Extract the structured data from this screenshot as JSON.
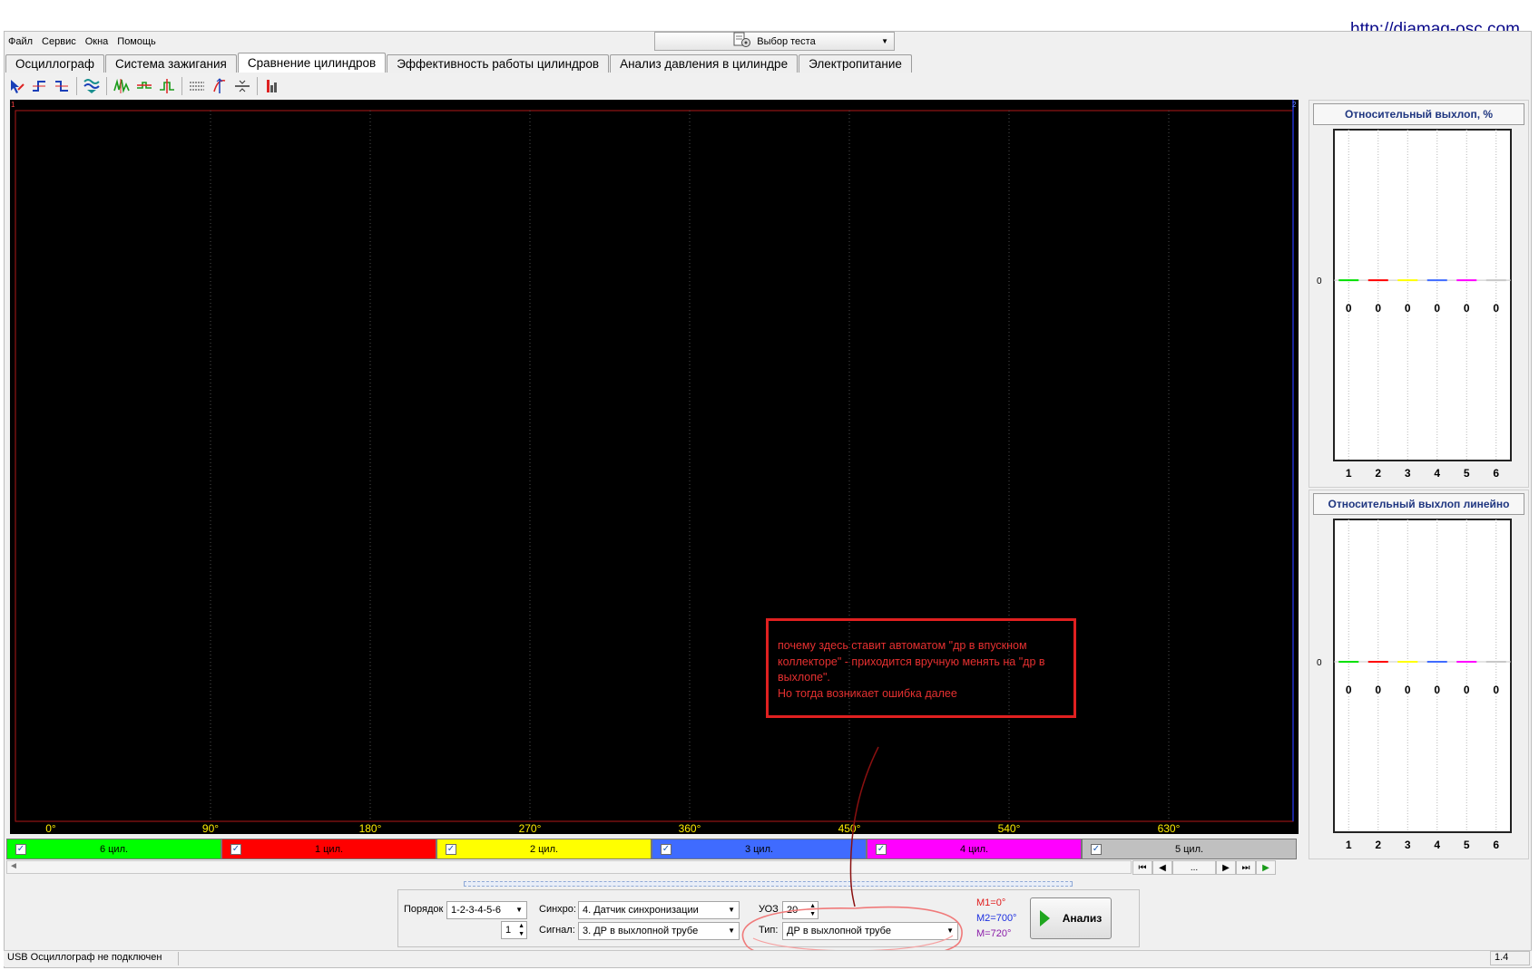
{
  "site_url": "http://diamag-osc.com",
  "menu": [
    "Файл",
    "Сервис",
    "Окна",
    "Помощь"
  ],
  "test_select": {
    "label": "Выбор теста"
  },
  "tabs": [
    {
      "label": "Осциллограф",
      "active": false
    },
    {
      "label": "Система зажигания",
      "active": false
    },
    {
      "label": "Сравнение цилиндров",
      "active": true
    },
    {
      "label": "Эффективность работы цилиндров",
      "active": false
    },
    {
      "label": "Анализ давления в цилиндре",
      "active": false
    },
    {
      "label": "Электропитание",
      "active": false
    }
  ],
  "scope": {
    "x_ticks": [
      "0°",
      "90°",
      "180°",
      "270°",
      "360°",
      "450°",
      "540°",
      "630°"
    ],
    "marker_1": "1",
    "marker_2": "2"
  },
  "channels": [
    {
      "label": "6 цил.",
      "color": "#00ff00",
      "checked": true
    },
    {
      "label": "1 цил.",
      "color": "#ff0000",
      "checked": true
    },
    {
      "label": "2 цил.",
      "color": "#ffff00",
      "checked": true
    },
    {
      "label": "3 цил.",
      "color": "#3f6bff",
      "checked": true
    },
    {
      "label": "4 цил.",
      "color": "#ff00ff",
      "checked": true
    },
    {
      "label": "5 цил.",
      "color": "#c0c0c0",
      "checked": true
    }
  ],
  "nav": {
    "ellipsis": "..."
  },
  "controls": {
    "order_label": "Порядок",
    "order_value": "1-2-3-4-5-6",
    "start_value": "1",
    "sync_label": "Синхро:",
    "sync_value": "4.  Датчик синхронизации",
    "signal_label": "Сигнал:",
    "signal_value": "3.  ДР в выхлопной трубе",
    "uoz_label": "УОЗ",
    "uoz_value": "20",
    "type_label": "Тип:",
    "type_value": "ДР в выхлопной трубе"
  },
  "markers": {
    "m1": "M1=0°",
    "m2": "M2=700°",
    "m": "M=720°"
  },
  "analyze_button": "Анализ",
  "panels": [
    {
      "title": "Относительный выхлоп, %",
      "zero_label": "0",
      "values": [
        "0",
        "0",
        "0",
        "0",
        "0",
        "0"
      ],
      "categories": [
        "1",
        "2",
        "3",
        "4",
        "5",
        "6"
      ]
    },
    {
      "title": "Относительный выхлоп линейно",
      "zero_label": "0",
      "values": [
        "0",
        "0",
        "0",
        "0",
        "0",
        "0"
      ],
      "categories": [
        "1",
        "2",
        "3",
        "4",
        "5",
        "6"
      ]
    }
  ],
  "bar_colors": [
    "#00e000",
    "#ff0000",
    "#ffff00",
    "#3f6bff",
    "#ff00ff",
    "#c8c8c8"
  ],
  "status": {
    "text": "USB Осциллограф не подключен",
    "version": "1.4"
  },
  "annotation": "почему здесь ставит автоматом \"др в впускном коллекторе\" - приходится вручную менять на \"др в выхлопе\".\nНо тогда возникает ошибка далее"
}
